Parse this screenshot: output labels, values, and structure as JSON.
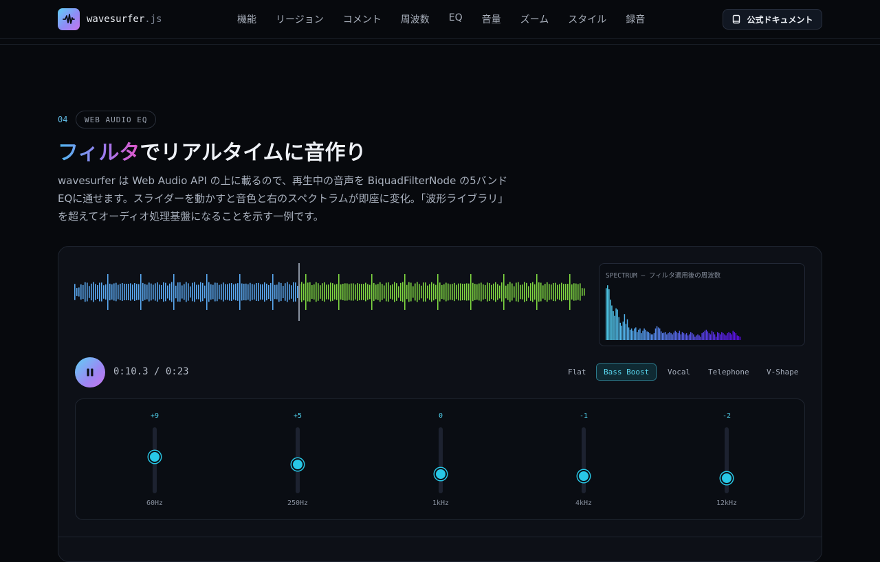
{
  "header": {
    "logo_name": "wavesurfer",
    "logo_ext": ".js",
    "nav": [
      "機能",
      "リージョン",
      "コメント",
      "周波数",
      "EQ",
      "音量",
      "ズーム",
      "スタイル",
      "録音"
    ],
    "doc_button": "公式ドキュメント"
  },
  "section": {
    "number": "04",
    "tag": "WEB AUDIO EQ",
    "title_highlight": "フィルタ",
    "title_rest": "でリアルタイムに音作り",
    "description": "wavesurfer は Web Audio API の上に載るので、再生中の音声を BiquadFilterNode の5バンドEQに通せます。スライダーを動かすと音色と右のスペクトラムが即座に変化。「波形ライブラリ」を超えてオーディオ処理基盤になることを示す一例です。"
  },
  "player": {
    "time": "0:10.3 / 0:23",
    "progress": 0.44,
    "colors": {
      "played": "#5aa8f0",
      "unplayed": "#7ed640",
      "cursor": "#8a93a2"
    }
  },
  "spectrum": {
    "label": "SPECTRUM — フィルタ適用後の周波数",
    "levels": [
      0.9,
      0.95,
      0.88,
      0.7,
      0.6,
      0.5,
      0.42,
      0.55,
      0.53,
      0.4,
      0.3,
      0.25,
      0.32,
      0.45,
      0.28,
      0.36,
      0.22,
      0.18,
      0.2,
      0.16,
      0.2,
      0.22,
      0.14,
      0.18,
      0.2,
      0.12,
      0.16,
      0.2,
      0.18,
      0.15,
      0.14,
      0.12,
      0.1,
      0.1,
      0.12,
      0.2,
      0.24,
      0.22,
      0.2,
      0.15,
      0.12,
      0.13,
      0.14,
      0.1,
      0.12,
      0.14,
      0.12,
      0.1,
      0.13,
      0.16,
      0.14,
      0.12,
      0.16,
      0.1,
      0.14,
      0.12,
      0.1,
      0.12,
      0.08,
      0.1,
      0.14,
      0.12,
      0.1,
      0.06,
      0.08,
      0.1,
      0.08,
      0.06,
      0.12,
      0.14,
      0.16,
      0.18,
      0.15,
      0.12,
      0.1,
      0.16,
      0.14,
      0.1,
      0.06,
      0.14,
      0.12,
      0.1,
      0.14,
      0.12,
      0.1,
      0.08,
      0.12,
      0.14,
      0.12,
      0.1,
      0.16,
      0.14,
      0.12,
      0.08,
      0.07,
      0.06
    ]
  },
  "presets": [
    {
      "label": "Flat",
      "active": false
    },
    {
      "label": "Bass Boost",
      "active": true
    },
    {
      "label": "Vocal",
      "active": false
    },
    {
      "label": "Telephone",
      "active": false
    },
    {
      "label": "V-Shape",
      "active": false
    }
  ],
  "eq": {
    "range_db": [
      -12,
      12
    ],
    "bands": [
      {
        "freq": "60Hz",
        "gain_label": "+9",
        "gain": 9
      },
      {
        "freq": "250Hz",
        "gain_label": "+5",
        "gain": 5
      },
      {
        "freq": "1kHz",
        "gain_label": "0",
        "gain": 0
      },
      {
        "freq": "4kHz",
        "gain_label": "-1",
        "gain": -1
      },
      {
        "freq": "12kHz",
        "gain_label": "-2",
        "gain": -2
      }
    ]
  }
}
